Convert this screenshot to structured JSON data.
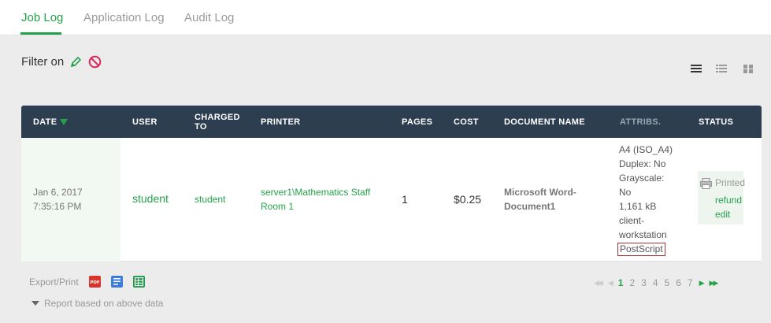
{
  "tabs": [
    {
      "label": "Job Log",
      "active": true
    },
    {
      "label": "Application Log",
      "active": false
    },
    {
      "label": "Audit Log",
      "active": false
    }
  ],
  "filter": {
    "label": "Filter on",
    "icons": [
      "pencil-icon",
      "clear-filter-icon"
    ]
  },
  "view_toggles": [
    "list-view-icon",
    "detail-view-icon",
    "grid-view-icon"
  ],
  "table": {
    "columns": [
      {
        "label": "DATE",
        "sorted": "desc"
      },
      {
        "label": "USER"
      },
      {
        "label": "CHARGED TO"
      },
      {
        "label": "PRINTER"
      },
      {
        "label": "PAGES"
      },
      {
        "label": "COST"
      },
      {
        "label": "DOCUMENT NAME"
      },
      {
        "label": "ATTRIBS."
      },
      {
        "label": "STATUS"
      }
    ],
    "rows": [
      {
        "date": "Jan 6, 2017",
        "time": "7:35:16 PM",
        "user": "student",
        "charged_to": "student",
        "printer_line1": "server1\\Mathematics Staff",
        "printer_line2": "Room 1",
        "pages": "1",
        "cost": "$0.25",
        "document_line1": "Microsoft Word-",
        "document_line2": "Document1",
        "attribs": [
          "A4 (ISO_A4)",
          "Duplex: No",
          "Grayscale:",
          "No",
          "1,161 kB",
          "client-",
          "workstation",
          "PostScript"
        ],
        "status": "Printed",
        "actions": [
          "refund",
          "edit"
        ]
      }
    ]
  },
  "footer": {
    "export_label": "Export/Print",
    "export_icons": [
      "pdf-icon",
      "html-icon",
      "csv-icon"
    ],
    "report_label": "Report based on above data"
  },
  "pagination": {
    "pages": [
      "1",
      "2",
      "3",
      "4",
      "5",
      "6",
      "7"
    ],
    "current": "1"
  },
  "colors": {
    "accent": "#23a24a",
    "header_bg": "#2c3e50",
    "page_bg": "#ececec",
    "highlight_border": "#aa3333"
  }
}
